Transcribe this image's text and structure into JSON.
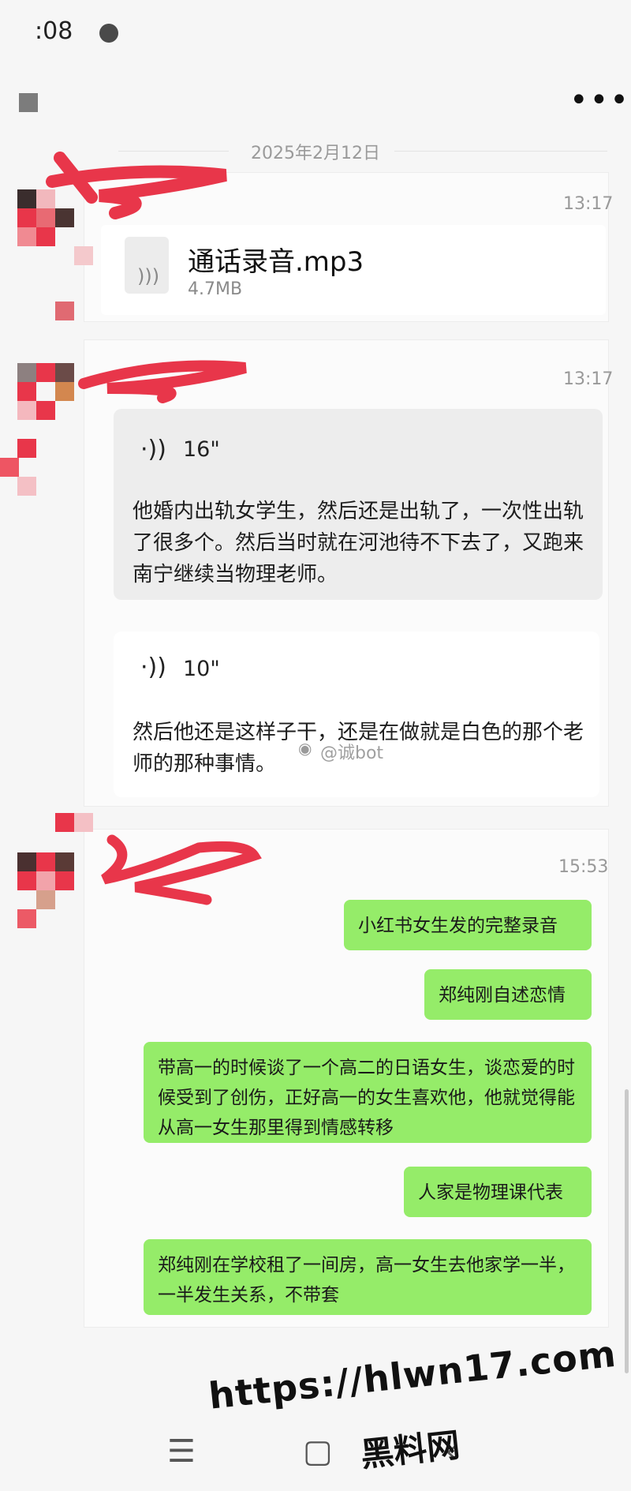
{
  "status": {
    "time": ":08"
  },
  "date_separator": "2025年2月12日",
  "messages": {
    "file": {
      "time": "13:17",
      "file_name": "通话录音.mp3",
      "file_size": "4.7MB",
      "icon": "audio-file-icon"
    },
    "voice": {
      "time": "13:17",
      "items": [
        {
          "duration": "16\"",
          "text": "他婚内出轨女学生，然后还是出轨了，一次性出轨了很多个。然后当时就在河池待不下去了，又跑来南宁继续当物理老师。"
        },
        {
          "duration": "10\"",
          "text": "然后他还是这样子干，还是在做就是白色的那个老师的那种事情。"
        }
      ]
    },
    "chat": {
      "time": "15:53",
      "bubbles": [
        "小红书女生发的完整录音",
        "郑纯刚自述恋情",
        "带高一的时候谈了一个高二的日语女生，谈恋爱的时候受到了创伤，正好高一的女生喜欢他，他就觉得能从高一女生那里得到情感转移",
        "人家是物理课代表",
        "郑纯刚在学校租了一间房，高一女生去他家学一半，一半发生关系，不带套"
      ]
    }
  },
  "watermark": "@诚bot",
  "overlay": {
    "url": "https://hlwn17.com",
    "name": "黑料网"
  },
  "colors": {
    "bubble": "#95ec69",
    "redaction": "#e8364a",
    "background": "#f6f6f6"
  }
}
